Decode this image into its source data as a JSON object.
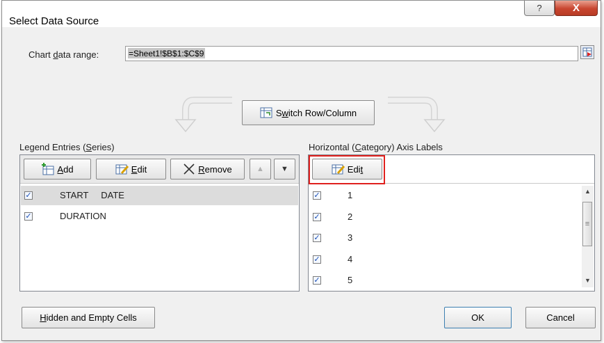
{
  "window": {
    "title": "Select Data Source",
    "help_glyph": "?",
    "close_glyph": "X"
  },
  "chart_range": {
    "label_pre": "Chart ",
    "label_key": "d",
    "label_post": "ata range:",
    "value": "=Sheet1!$B$1:$C$9"
  },
  "switch_button": {
    "pre": "S",
    "key": "w",
    "post": "itch Row/Column"
  },
  "legend": {
    "heading_pre": "Legend Entries (",
    "heading_key": "S",
    "heading_post": "eries)",
    "add": {
      "key": "A",
      "rest": "dd"
    },
    "edit": {
      "key": "E",
      "rest": "dit"
    },
    "remove": {
      "key": "R",
      "rest": "emove"
    },
    "up_glyph": "▲",
    "down_glyph": "▼",
    "series": [
      {
        "name": "START     DATE",
        "checked": true
      },
      {
        "name": "DURATION",
        "checked": true
      }
    ]
  },
  "axis": {
    "heading_pre": "Horizontal (",
    "heading_key": "C",
    "heading_post": "ategory) Axis Labels",
    "edit": {
      "pre": "Edi",
      "key": "t"
    },
    "labels": [
      "1",
      "2",
      "3",
      "4",
      "5"
    ],
    "scroll_up": "▲",
    "scroll_down": "▼",
    "thumb_grip": "≡"
  },
  "footer": {
    "hidden": {
      "key": "H",
      "rest": "idden and Empty Cells"
    },
    "ok": "OK",
    "cancel": "Cancel"
  },
  "check_glyph": "✓"
}
